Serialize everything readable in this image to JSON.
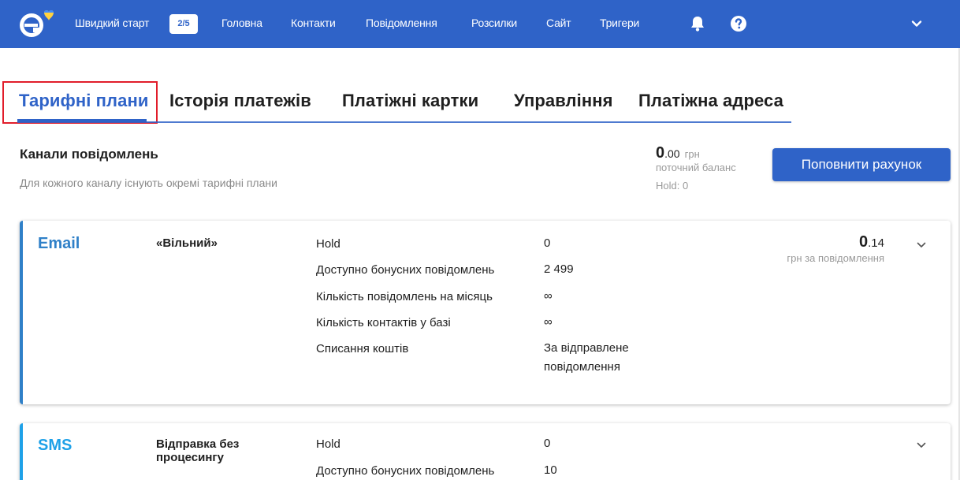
{
  "topbar": {
    "bg_color": "#2f63c8",
    "logo_icon": "esputnik-logo-heart",
    "quick_start_label": "Швидкий старт",
    "quick_start_progress": "2/5",
    "nav": [
      "Головна",
      "Контакти",
      "Повідомлення",
      "Розсилки",
      "Сайт",
      "Тригери"
    ],
    "icons": [
      "bell-icon",
      "help-icon",
      "chevron-down-icon"
    ]
  },
  "tabs": [
    "Тарифні плани",
    "Історія платежів",
    "Платіжні картки",
    "Управління",
    "Платіжна адреса"
  ],
  "active_tab": 0,
  "channels": {
    "title": "Канали повідомлень",
    "subtitle": "Для кожного каналу існують окремі тарифні плани",
    "balance_int": "0",
    "balance_frac": ".00",
    "balance_currency": "грн",
    "balance_label": "поточний баланс",
    "hold": "Hold: 0",
    "topup_label": "Поповнити рахунок"
  },
  "cards": [
    {
      "channel": "Email",
      "plan": "«Вільний»",
      "rows": [
        {
          "label": "Hold",
          "value": "0"
        },
        {
          "label": "Доступно бонусних повідомлень",
          "value": "2 499"
        },
        {
          "label": "Кількість повідомлень на місяць",
          "value": "∞"
        },
        {
          "label": "Кількість контактів у базі",
          "value": "∞"
        },
        {
          "label": "Списання коштів",
          "value": "За відправлене повідомлення"
        }
      ],
      "price_int": "0",
      "price_frac": ".14",
      "price_label": "грн за повідомлення"
    },
    {
      "channel": "SMS",
      "plan": "Відправка без процесингу",
      "rows": [
        {
          "label": "Hold",
          "value": "0"
        },
        {
          "label": "Доступно бонусних повідомлень",
          "value": "10"
        }
      ]
    }
  ]
}
